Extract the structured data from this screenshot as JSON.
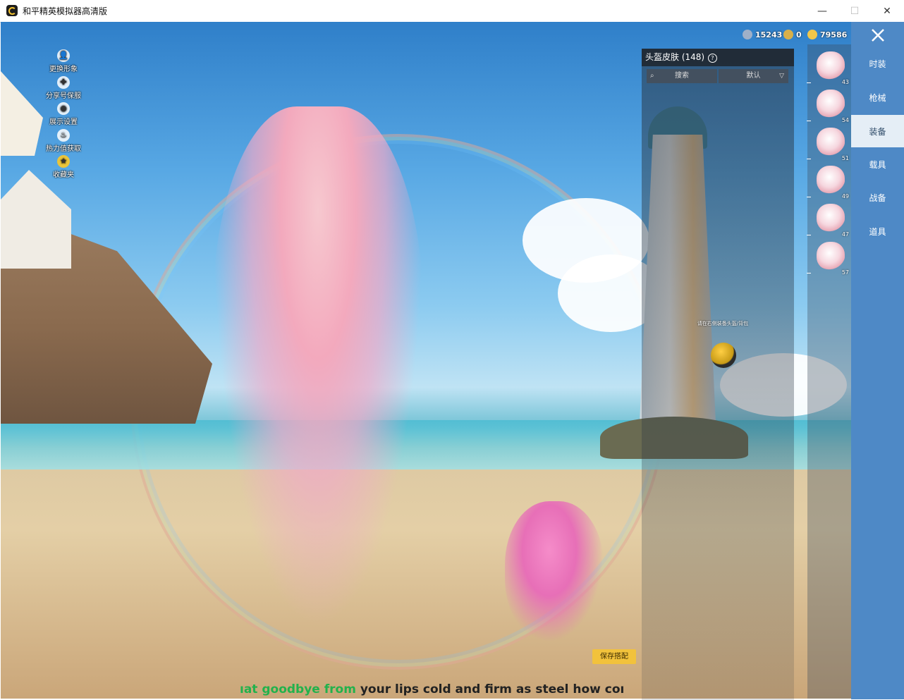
{
  "window": {
    "title": "和平精英模拟器高清版",
    "minimize": "—",
    "maximize": "☐",
    "close": "✕"
  },
  "left_menu": [
    {
      "label": "更换形象",
      "icon": "person-icon"
    },
    {
      "label": "分享号保服",
      "icon": "share-icon"
    },
    {
      "label": "展示设置",
      "icon": "eye-icon"
    },
    {
      "label": "热力值获取",
      "icon": "flame-icon"
    },
    {
      "label": "收藏夹",
      "icon": "bookmark-icon"
    }
  ],
  "currency": {
    "coupon": "15243",
    "gold_token": "0",
    "coin": "79586"
  },
  "panel": {
    "title": "头盔皮肤 (148)",
    "help_glyph": "?",
    "search_label": "搜索",
    "sort_label": "默认",
    "hint": "请在右侧装备头盔/背包"
  },
  "items": [
    {
      "count": "43"
    },
    {
      "count": "54"
    },
    {
      "count": "51"
    },
    {
      "count": "49"
    },
    {
      "count": "47"
    },
    {
      "count": "57"
    }
  ],
  "tabs": [
    {
      "label": "时装"
    },
    {
      "label": "枪械"
    },
    {
      "label": "装备"
    },
    {
      "label": "载具"
    },
    {
      "label": "战备"
    },
    {
      "label": "道具"
    }
  ],
  "active_tab": "装备",
  "save_button": "保存搭配",
  "subtitle": {
    "highlight": "ıat goodbye from",
    "rest": " your lips cold and firm as steel how coı"
  },
  "colors": {
    "tab_bar": "#4e89c6",
    "save_button": "#f2c23c",
    "subtitle_highlight": "#22b24c"
  }
}
